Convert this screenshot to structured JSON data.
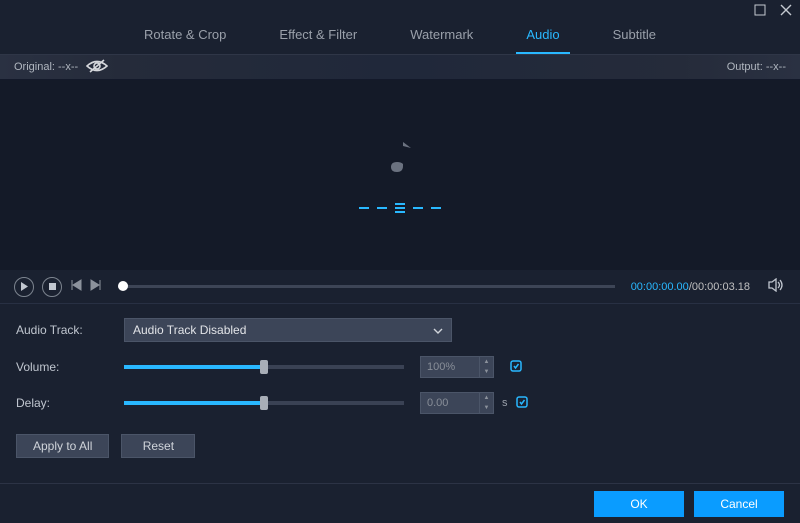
{
  "tabs": {
    "rotate": "Rotate & Crop",
    "effect": "Effect & Filter",
    "watermark": "Watermark",
    "audio": "Audio",
    "subtitle": "Subtitle"
  },
  "infobar": {
    "original_label": "Original: --x--",
    "output_label": "Output: --x--"
  },
  "playback": {
    "current": "00:00:00.00",
    "sep": "/",
    "total": "00:00:03.18"
  },
  "settings": {
    "track_label": "Audio Track:",
    "track_value": "Audio Track Disabled",
    "volume_label": "Volume:",
    "volume_value": "100%",
    "volume_pct": 50,
    "delay_label": "Delay:",
    "delay_value": "0.00",
    "delay_unit": "s",
    "delay_pct": 50
  },
  "buttons": {
    "apply_all": "Apply to All",
    "reset": "Reset",
    "ok": "OK",
    "cancel": "Cancel"
  },
  "colors": {
    "accent": "#29b8ff",
    "primary_btn": "#0a9cff"
  }
}
